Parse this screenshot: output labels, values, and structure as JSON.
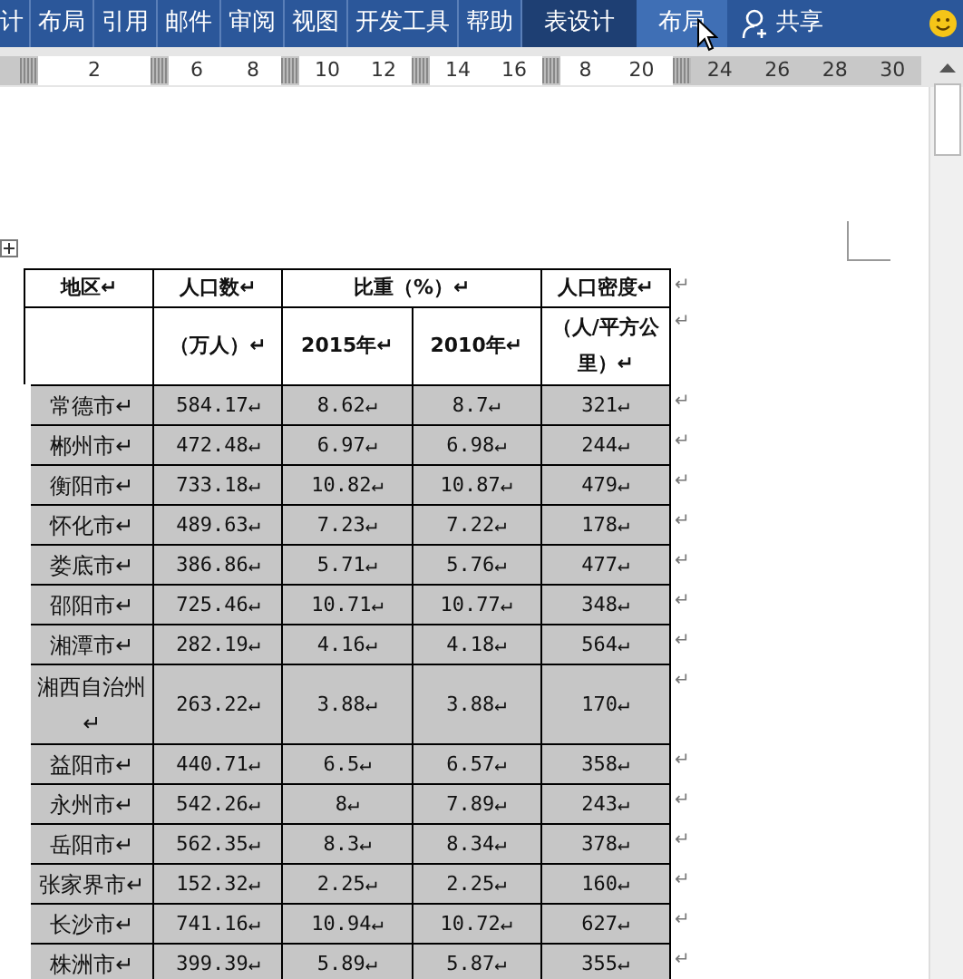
{
  "ribbon_tabs": [
    {
      "label": "计",
      "kind": "normal",
      "selected": false
    },
    {
      "label": "布局",
      "kind": "normal",
      "selected": false
    },
    {
      "label": "引用",
      "kind": "normal",
      "selected": false
    },
    {
      "label": "邮件",
      "kind": "normal",
      "selected": false
    },
    {
      "label": "审阅",
      "kind": "normal",
      "selected": false
    },
    {
      "label": "视图",
      "kind": "normal",
      "selected": false
    },
    {
      "label": "开发工具",
      "kind": "normal",
      "selected": false
    },
    {
      "label": "帮助",
      "kind": "normal",
      "selected": false
    },
    {
      "label": "表设计",
      "kind": "context",
      "selected": false
    },
    {
      "label": "布局",
      "kind": "context",
      "selected": true
    }
  ],
  "share_button": {
    "label": "共享"
  },
  "ruler": {
    "segments": [
      [
        "2"
      ],
      [
        "6",
        "8"
      ],
      [
        "10",
        "12"
      ],
      [
        "14",
        "16"
      ],
      [
        "8",
        "20"
      ]
    ],
    "outer_labels": [
      "24",
      "26",
      "28",
      "30"
    ]
  },
  "table": {
    "header_rows": [
      [
        "地区↵",
        "人口数↵",
        "比重（%）↵",
        "人口密度↵"
      ],
      [
        "",
        "（万人）↵",
        "2015年↵",
        "2010年↵",
        "（人/平方公里）↵"
      ]
    ],
    "header_end_marks": [
      "↵",
      "↵"
    ],
    "rows": [
      {
        "cells": [
          "常德市↵",
          "584.17↵",
          "8.62↵",
          "8.7↵",
          "321↵"
        ],
        "end_mark": "↵",
        "selected": true
      },
      {
        "cells": [
          "郴州市↵",
          "472.48↵",
          "6.97↵",
          "6.98↵",
          "244↵"
        ],
        "end_mark": "↵",
        "selected": true
      },
      {
        "cells": [
          "衡阳市↵",
          "733.18↵",
          "10.82↵",
          "10.87↵",
          "479↵"
        ],
        "end_mark": "↵",
        "selected": true
      },
      {
        "cells": [
          "怀化市↵",
          "489.63↵",
          "7.23↵",
          "7.22↵",
          "178↵"
        ],
        "end_mark": "↵",
        "selected": true
      },
      {
        "cells": [
          "娄底市↵",
          "386.86↵",
          "5.71↵",
          "5.76↵",
          "477↵"
        ],
        "end_mark": "↵",
        "selected": true
      },
      {
        "cells": [
          "邵阳市↵",
          "725.46↵",
          "10.71↵",
          "10.77↵",
          "348↵"
        ],
        "end_mark": "↵",
        "selected": true
      },
      {
        "cells": [
          "湘潭市↵",
          "282.19↵",
          "4.16↵",
          "4.18↵",
          "564↵"
        ],
        "end_mark": "↵",
        "selected": true
      },
      {
        "cells": [
          "湘西自治州↵",
          "263.22↵",
          "3.88↵",
          "3.88↵",
          "170↵"
        ],
        "end_mark": "↵",
        "selected": true
      },
      {
        "cells": [
          "益阳市↵",
          "440.71↵",
          "6.5↵",
          "6.57↵",
          "358↵"
        ],
        "end_mark": "↵",
        "selected": true
      },
      {
        "cells": [
          "永州市↵",
          "542.26↵",
          "8↵",
          "7.89↵",
          "243↵"
        ],
        "end_mark": "↵",
        "selected": true
      },
      {
        "cells": [
          "岳阳市↵",
          "562.35↵",
          "8.3↵",
          "8.34↵",
          "378↵"
        ],
        "end_mark": "↵",
        "selected": true
      },
      {
        "cells": [
          "张家界市↵",
          "152.32↵",
          "2.25↵",
          "2.25↵",
          "160↵"
        ],
        "end_mark": "↵",
        "selected": true
      },
      {
        "cells": [
          "长沙市↵",
          "741.16↵",
          "10.94↵",
          "10.72↵",
          "627↵"
        ],
        "end_mark": "↵",
        "selected": true
      },
      {
        "cells": [
          "株洲市↵",
          "399.39↵",
          "5.89↵",
          "5.87↵",
          "355↵"
        ],
        "end_mark": "↵",
        "selected": true
      }
    ]
  }
}
